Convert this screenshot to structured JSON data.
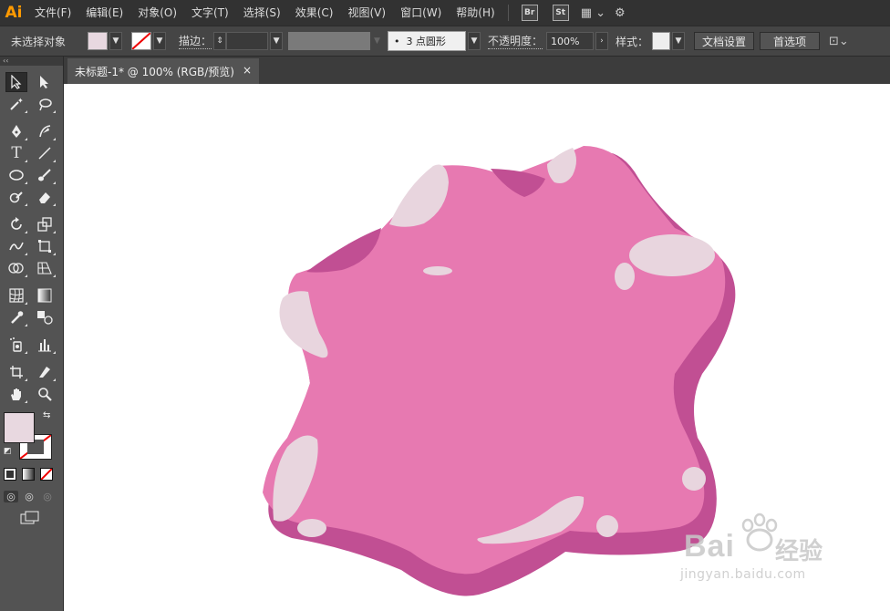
{
  "app": {
    "logo": "Ai"
  },
  "menu": [
    "文件(F)",
    "编辑(E)",
    "对象(O)",
    "文字(T)",
    "选择(S)",
    "效果(C)",
    "视图(V)",
    "窗口(W)",
    "帮助(H)"
  ],
  "menu_badges": {
    "bridge": "Br",
    "stock": "St"
  },
  "control": {
    "selection_label": "未选择对象",
    "stroke_label": "描边：",
    "brush_value": "3 点圆形",
    "opacity_label": "不透明度：",
    "opacity_value": "100%",
    "style_label": "样式：",
    "doc_settings": "文档设置",
    "preferences": "首选项"
  },
  "colors": {
    "fill": "#e8d8e0",
    "shape_main": "#e779b1",
    "shape_shadow": "#c14f93",
    "highlight": "#e8d5de"
  },
  "document": {
    "tab_title": "未标题-1* @ 100% (RGB/预览)",
    "close": "×"
  },
  "tools_panel": {
    "collapse": "‹‹"
  },
  "watermark": {
    "brand": "Bai",
    "cn": "经验",
    "url": "jingyan.baidu.com"
  }
}
